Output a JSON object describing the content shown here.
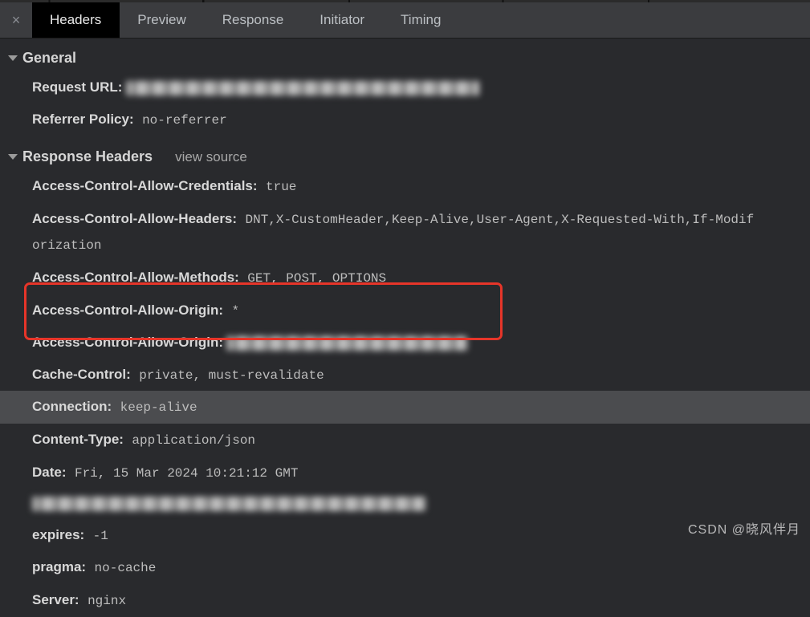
{
  "tabs": {
    "headers": "Headers",
    "preview": "Preview",
    "response": "Response",
    "initiator": "Initiator",
    "timing": "Timing"
  },
  "sections": {
    "general": "General",
    "responseHeaders": "Response Headers",
    "viewSource": "view source"
  },
  "general": {
    "requestUrl": {
      "name": "Request URL:"
    },
    "referrerPolicy": {
      "name": "Referrer Policy:",
      "value": "no-referrer"
    }
  },
  "responseHeaders": {
    "acac": {
      "name": "Access-Control-Allow-Credentials:",
      "value": "true"
    },
    "acah": {
      "name": "Access-Control-Allow-Headers:",
      "value": "DNT,X-CustomHeader,Keep-Alive,User-Agent,X-Requested-With,If-Modif"
    },
    "acahCont": "orization",
    "acam": {
      "name": "Access-Control-Allow-Methods:",
      "value": "GET, POST, OPTIONS"
    },
    "acao1": {
      "name": "Access-Control-Allow-Origin:",
      "value": "*"
    },
    "acao2": {
      "name": "Access-Control-Allow-Origin:"
    },
    "cache": {
      "name": "Cache-Control:",
      "value": "private, must-revalidate"
    },
    "conn": {
      "name": "Connection:",
      "value": "keep-alive"
    },
    "ctype": {
      "name": "Content-Type:",
      "value": "application/json"
    },
    "date": {
      "name": "Date:",
      "value": "Fri, 15 Mar 2024 10:21:12 GMT"
    },
    "expires": {
      "name": "expires:",
      "value": "-1"
    },
    "pragma": {
      "name": "pragma:",
      "value": "no-cache"
    },
    "server": {
      "name": "Server:",
      "value": "nginx"
    }
  },
  "watermark": "CSDN @晓风伴月"
}
